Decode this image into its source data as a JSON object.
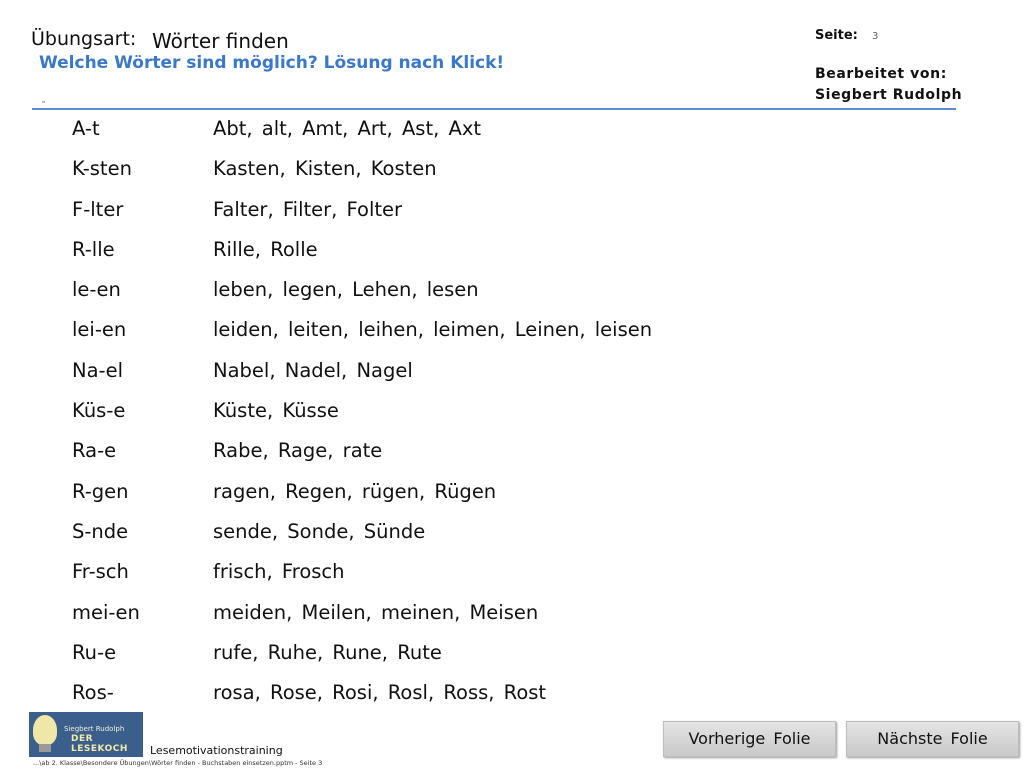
{
  "header": {
    "label": "Übungsart:",
    "title": "Wörter finden",
    "subtitle": "Welche Wörter sind möglich? Lösung nach Klick!",
    "page_label": "Seite:",
    "page_number": "3",
    "edited_label": "Bearbeitet  von:",
    "edited_name": "Siegbert  Rudolph"
  },
  "exercise": {
    "rows": [
      {
        "pattern": "A-t",
        "solution": "Abt,  alt,  Amt,  Art,  Ast,  Axt"
      },
      {
        "pattern": "K-sten",
        "solution": "Kasten,  Kisten,  Kosten"
      },
      {
        "pattern": "F-lter",
        "solution": "Falter,  Filter,  Folter"
      },
      {
        "pattern": "R-lle",
        "solution": "Rille,  Rolle"
      },
      {
        "pattern": "le-en",
        "solution": "leben,  legen,  Lehen,  lesen"
      },
      {
        "pattern": "lei-en",
        "solution": "leiden, leiten, leihen,  leimen,  Leinen, leisen"
      },
      {
        "pattern": "Na-el",
        "solution": "Nabel,  Nadel,  Nagel"
      },
      {
        "pattern": "Küs-e",
        "solution": "Küste,  Küsse"
      },
      {
        "pattern": "Ra-e",
        "solution": "Rabe,  Rage,  rate"
      },
      {
        "pattern": "R-gen",
        "solution": "ragen,  Regen,  rügen,  Rügen"
      },
      {
        "pattern": "S-nde",
        "solution": "sende,  Sonde,  Sünde"
      },
      {
        "pattern": "Fr-sch",
        "solution": "frisch,  Frosch"
      },
      {
        "pattern": "mei-en",
        "solution": "meiden,  Meilen,  meinen,  Meisen"
      },
      {
        "pattern": "Ru-e",
        "solution": "rufe,  Ruhe,  Rune,  Rute"
      },
      {
        "pattern": "Ros-",
        "solution": "rosa,  Rose,  Rosi,  Rosl,  Ross,  Rost"
      }
    ]
  },
  "footer": {
    "logo_name": "Siegbert Rudolph",
    "logo_brand": "DER LESEKOCH",
    "brand": "Lesemotivationstraining",
    "path": "...\\ab 2. Klasse\\Besondere Übungen\\Wörter finden - Buchstaben einsetzen.pptm - Seite 3"
  },
  "navigation": {
    "prev_label": "Vorherige  Folie",
    "next_label": "Nächste  Folie"
  },
  "colors": {
    "accent": "#3a78c9",
    "rule": "#5b8bd0"
  }
}
